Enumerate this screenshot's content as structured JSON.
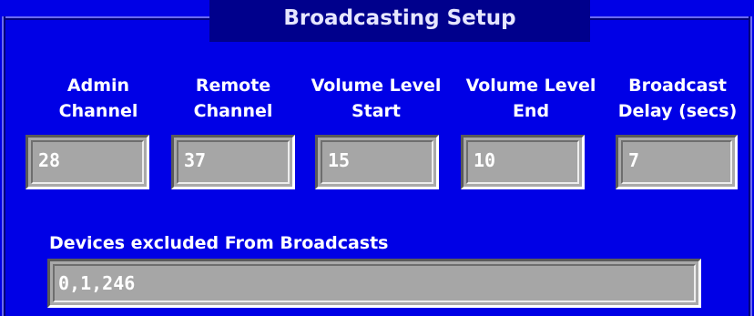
{
  "title": "Broadcasting Setup",
  "fields": [
    {
      "label": "Admin\nChannel",
      "value": "28"
    },
    {
      "label": "Remote\nChannel",
      "value": "37"
    },
    {
      "label": "Volume Level\nStart",
      "value": "15"
    },
    {
      "label": "Volume Level\nEnd",
      "value": "10"
    },
    {
      "label": "Broadcast\nDelay (secs)",
      "value": "7"
    }
  ],
  "excluded": {
    "label": "Devices excluded From Broadcasts",
    "value": "0,1,246"
  },
  "colors": {
    "panel_bg": "#0000e6",
    "title_bg": "#00008c",
    "field_bg": "#a6a6a6",
    "text": "#ffffff"
  }
}
